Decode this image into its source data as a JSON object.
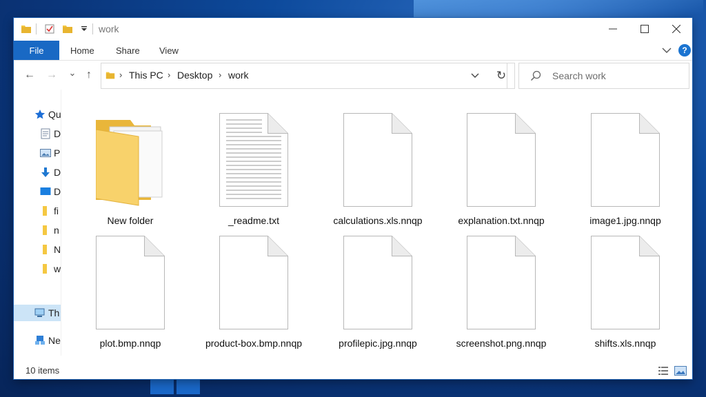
{
  "window": {
    "title": "work",
    "controls": {
      "minimize": "—",
      "maximize": "☐",
      "close": "✕"
    }
  },
  "ribbon": {
    "tabs": [
      "File",
      "Home",
      "Share",
      "View"
    ],
    "help": "?"
  },
  "navigation": {
    "back": "←",
    "forward": "→",
    "recent": "⌄",
    "up": "↑",
    "breadcrumb": [
      "This PC",
      "Desktop",
      "work"
    ],
    "separator": "›",
    "refresh": "↻"
  },
  "search": {
    "placeholder": "Search work"
  },
  "sidebar": {
    "items": [
      {
        "label": "Qu",
        "icon": "star-icon"
      },
      {
        "label": "D",
        "icon": "document-icon"
      },
      {
        "label": "P",
        "icon": "picture-icon"
      },
      {
        "label": "D",
        "icon": "download-icon"
      },
      {
        "label": "D",
        "icon": "desktop-icon"
      },
      {
        "label": "fi",
        "icon": "folder-icon"
      },
      {
        "label": "n",
        "icon": "folder-icon"
      },
      {
        "label": "N",
        "icon": "folder-icon"
      },
      {
        "label": "w",
        "icon": "folder-icon"
      },
      {
        "label": "Th",
        "icon": "pc-icon"
      },
      {
        "label": "Ne",
        "icon": "network-icon"
      }
    ]
  },
  "files": [
    {
      "name": "New folder",
      "type": "folder"
    },
    {
      "name": "_readme.txt",
      "type": "text"
    },
    {
      "name": "calculations.xls.nnqp",
      "type": "blank"
    },
    {
      "name": "explanation.txt.nnqp",
      "type": "blank"
    },
    {
      "name": "image1.jpg.nnqp",
      "type": "blank"
    },
    {
      "name": "plot.bmp.nnqp",
      "type": "blank"
    },
    {
      "name": "product-box.bmp.nnqp",
      "type": "blank"
    },
    {
      "name": "profilepic.jpg.nnqp",
      "type": "blank"
    },
    {
      "name": "screenshot.png.nnqp",
      "type": "blank"
    },
    {
      "name": "shifts.xls.nnqp",
      "type": "blank"
    }
  ],
  "status": {
    "item_count": "10 items"
  },
  "colors": {
    "accent": "#1969c4",
    "selected": "#cce4f7",
    "folder": "#f5c842"
  }
}
